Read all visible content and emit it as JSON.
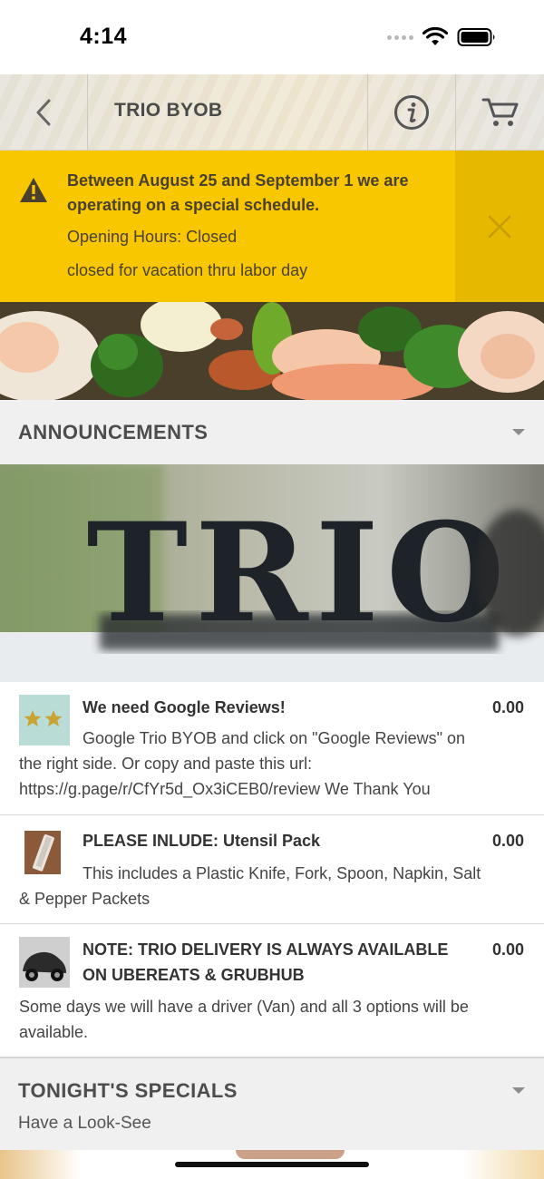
{
  "status_bar": {
    "time": "4:14"
  },
  "nav": {
    "title": "TRIO BYOB"
  },
  "alert": {
    "headline": "Between August 25 and September 1 we are operating on a special schedule.",
    "hours": "Opening Hours: Closed",
    "note": "closed for vacation thru labor day"
  },
  "sections": {
    "announcements": {
      "title": "ANNOUNCEMENTS"
    },
    "specials": {
      "title": "TONIGHT'S SPECIALS",
      "subtitle": "Have a Look-See"
    }
  },
  "image_text": {
    "trio_sign": "TRIO"
  },
  "items": [
    {
      "title": "We need Google Reviews!",
      "price": "0.00",
      "description": "Google Trio BYOB and click on \"Google Reviews\" on the right side. Or copy and paste this url: https://g.page/r/CfYr5d_Ox3iCEB0/review We Thank You"
    },
    {
      "title": "PLEASE INLUDE: Utensil Pack",
      "price": "0.00",
      "description": "This includes a Plastic Knife, Fork, Spoon, Napkin, Salt & Pepper Packets"
    },
    {
      "title": "NOTE: TRIO DELIVERY IS ALWAYS AVAILABLE ON UBEREATS & GRUBHUB",
      "price": "0.00",
      "description": "Some days we will have a driver (Van) and all 3 options will be available."
    }
  ],
  "icons": {
    "back": "chevron-left-icon",
    "info": "info-icon",
    "cart": "cart-icon",
    "warning": "warning-icon",
    "close": "close-icon"
  },
  "colors": {
    "alert_bg": "#f8c700",
    "alert_close_bg": "#e6b800",
    "section_bg": "#f0f0f0"
  }
}
